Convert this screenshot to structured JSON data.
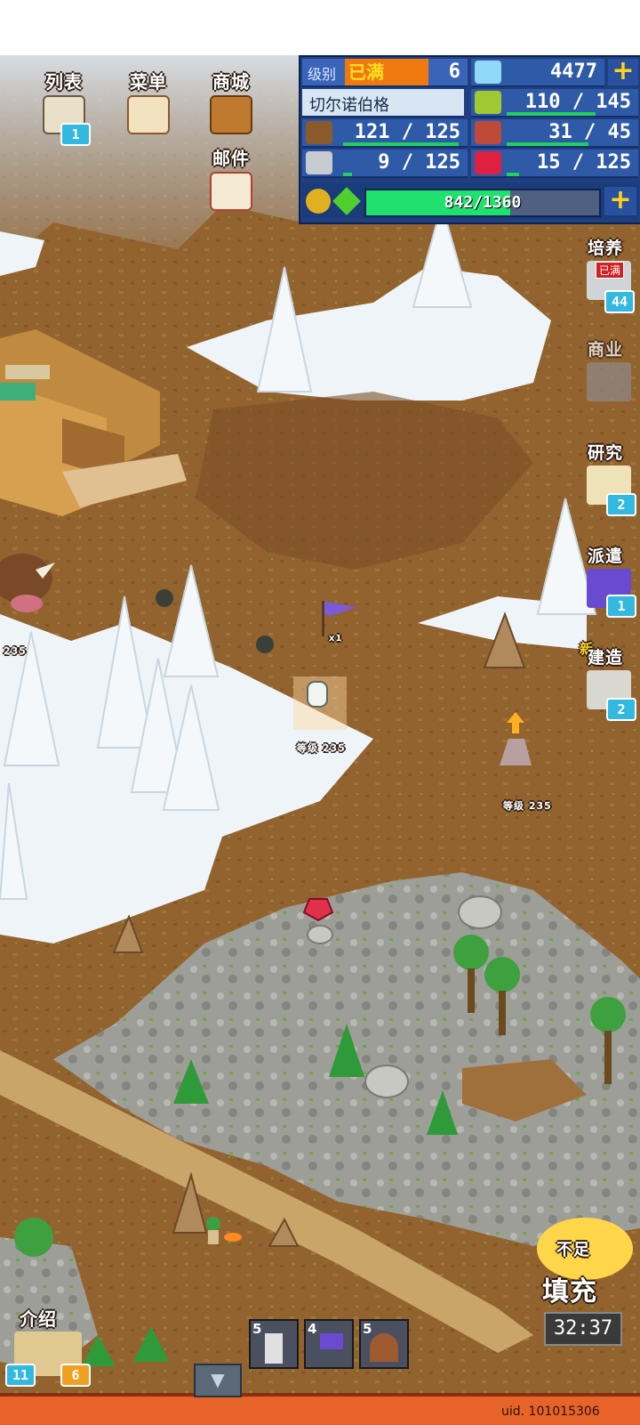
{
  "top_buttons": {
    "list": "列表",
    "list_badge": "1",
    "menu": "菜单",
    "shop": "商城",
    "mail": "邮件"
  },
  "resources": {
    "level_label": "级别",
    "level_max": "已满",
    "level_value": "6",
    "gems": "4477",
    "city_name": "切尔诺伯格",
    "food": "110 / 145",
    "wood": "121 / 125",
    "meat": "31 / 45",
    "stone": "9 / 125",
    "ruby": "15 / 125",
    "exp": "842/1360"
  },
  "side_menu": {
    "cultivate": "培养",
    "cultivate_tag": "已满",
    "cultivate_badge": "44",
    "business": "商业",
    "research": "研究",
    "research_badge": "2",
    "dispatch": "派遣",
    "dispatch_badge": "1",
    "new_tag": "新",
    "build": "建造",
    "build_badge": "2"
  },
  "map_labels": {
    "level1": "等级 235",
    "level2": "等级 235",
    "level3": "235",
    "flag": "x1"
  },
  "bottom": {
    "intro": "介绍",
    "intro_badge1": "11",
    "intro_badge2": "6",
    "slot1": "5",
    "slot2": "4",
    "slot3": "5",
    "refill_tag": "不足",
    "refill": "填充",
    "timer": "32:37",
    "uid": "uid. 101015306"
  },
  "colors": {
    "dirt": "#9a6a38",
    "snow": "#eef4f8",
    "rock": "#9a9a95",
    "panel": "#2e5aa8",
    "accent": "#ffd21a"
  }
}
